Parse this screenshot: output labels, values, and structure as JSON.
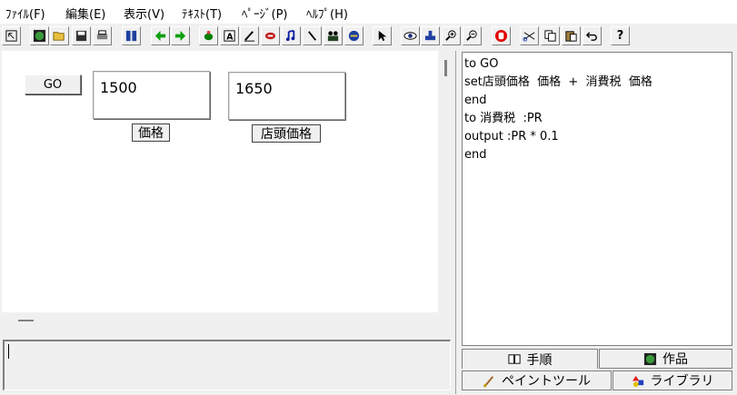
{
  "menu": [
    {
      "label": "ﾌｧｲﾙ(F)"
    },
    {
      "label": "編集(E)"
    },
    {
      "label": "表示(V)"
    },
    {
      "label": "ﾃｷｽﾄ(T)"
    },
    {
      "label": "ﾍﾟｰｼﾞ(P)"
    },
    {
      "label": "ﾍﾙﾌﾟ(H)"
    }
  ],
  "toolbar": {
    "icons": [
      "cursor-arrow-icon",
      "globe-icon",
      "open-folder-icon",
      "save-icon",
      "print-icon",
      "page-icon",
      "arrow-left-icon",
      "arrow-right-icon",
      "turtle-icon",
      "text-box-icon",
      "pen-icon",
      "eraser-icon",
      "music-icon",
      "brush-icon",
      "people-icon",
      "globe-image-icon",
      "pointer-icon",
      "eye-icon",
      "stamp-icon",
      "zoom-in-icon",
      "zoom-out-icon",
      "stop-hand-icon",
      "cut-icon",
      "copy-icon",
      "paste-icon",
      "undo-icon",
      "help-icon"
    ],
    "help_label": "?"
  },
  "stage": {
    "go_button": "GO",
    "fields": [
      {
        "value": "1500",
        "label": "価格"
      },
      {
        "value": "1650",
        "label": "店頭価格"
      }
    ]
  },
  "script": {
    "lines": [
      "to GO",
      "set店頭価格  価格  +  消費税  価格",
      "end",
      "to 消費税  :PR",
      "output :PR * 0.1",
      "end"
    ]
  },
  "tabs": {
    "procedures": "手順",
    "works": "作品",
    "paint_tool": "ペイントツール",
    "library": "ライブラリ"
  },
  "colors": {
    "turtle_green": "#008000",
    "stop_red": "#e00000"
  }
}
